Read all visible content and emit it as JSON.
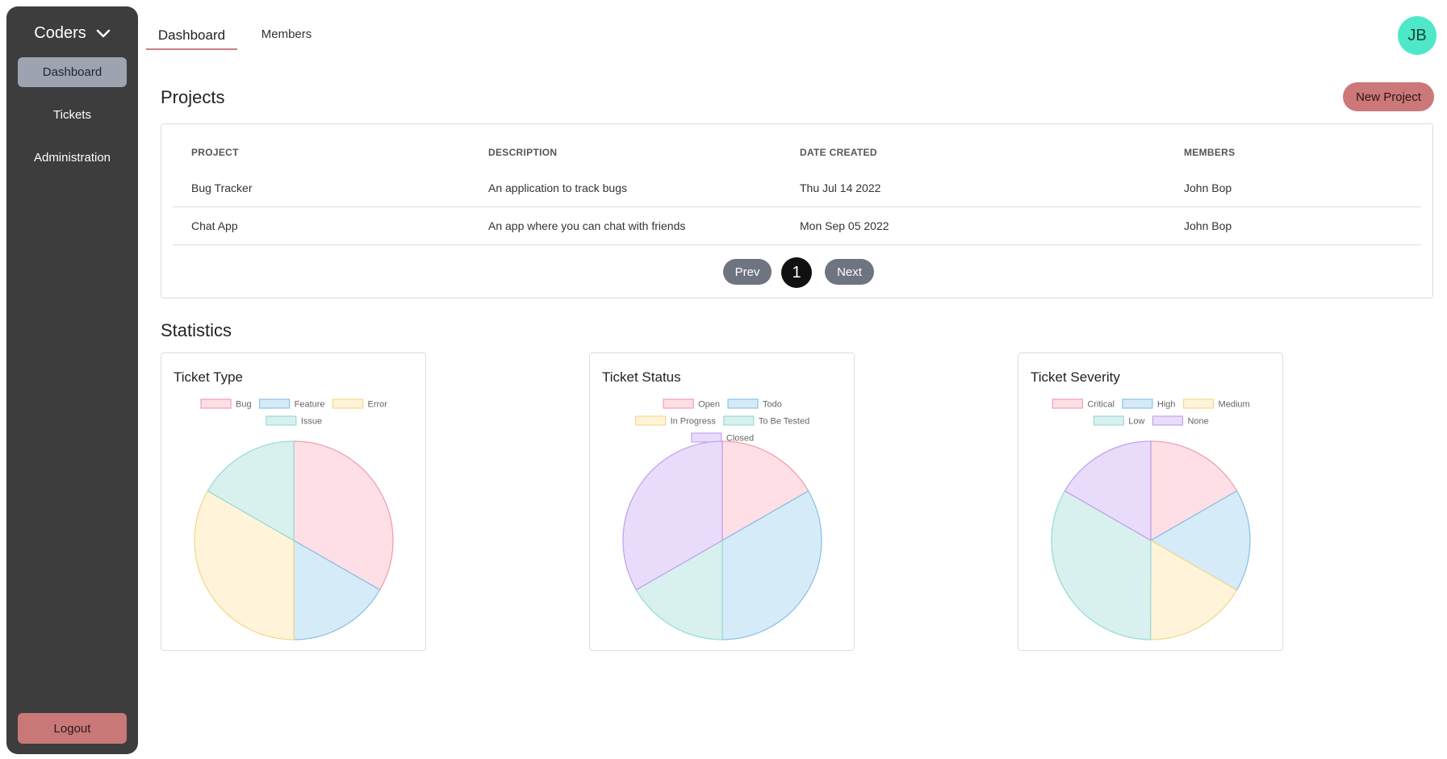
{
  "sidebar": {
    "org_name": "Coders",
    "items": [
      {
        "label": "Dashboard",
        "active": true
      },
      {
        "label": "Tickets",
        "active": false
      },
      {
        "label": "Administration",
        "active": false
      }
    ],
    "logout_label": "Logout"
  },
  "header": {
    "tabs": [
      {
        "label": "Dashboard",
        "active": true
      },
      {
        "label": "Members",
        "active": false
      }
    ],
    "avatar_initials": "JB"
  },
  "projects": {
    "title": "Projects",
    "new_project_label": "New Project",
    "columns": [
      "PROJECT",
      "DESCRIPTION",
      "DATE CREATED",
      "MEMBERS"
    ],
    "rows": [
      {
        "project": "Bug Tracker",
        "description": "An application to track bugs",
        "date": "Thu Jul 14 2022",
        "members": "John Bop"
      },
      {
        "project": "Chat App",
        "description": "An app where you can chat with friends",
        "date": "Mon Sep 05 2022",
        "members": "John Bop"
      }
    ],
    "pagination": {
      "prev_label": "Prev",
      "current_page": "1",
      "next_label": "Next"
    }
  },
  "statistics": {
    "title": "Statistics"
  },
  "chart_data": [
    {
      "type": "pie",
      "title": "Ticket Type",
      "labels": [
        "Bug",
        "Feature",
        "Error",
        "Issue"
      ],
      "values": [
        33.3,
        16.7,
        33.3,
        16.7
      ],
      "colors": [
        "#ffdfe6",
        "#d6ebf8",
        "#fff4d9",
        "#d8f1ee"
      ],
      "borders": [
        "#ef9eb2",
        "#8ec2e6",
        "#f3d88e",
        "#9bdcd6"
      ],
      "legend": "top"
    },
    {
      "type": "pie",
      "title": "Ticket Status",
      "labels": [
        "Open",
        "Todo",
        "In Progress",
        "To Be Tested",
        "Closed"
      ],
      "values": [
        16.7,
        33.3,
        0,
        16.7,
        33.3
      ],
      "colors": [
        "#ffdfe6",
        "#d6ebf8",
        "#fff4d9",
        "#d8f1ee",
        "#e9dcfa"
      ],
      "borders": [
        "#ef9eb2",
        "#8ec2e6",
        "#f3d88e",
        "#9bdcd6",
        "#c3a3ee"
      ],
      "legend": "top"
    },
    {
      "type": "pie",
      "title": "Ticket Severity",
      "labels": [
        "Critical",
        "High",
        "Medium",
        "Low",
        "None"
      ],
      "values": [
        16.7,
        16.7,
        16.7,
        33.3,
        16.7
      ],
      "colors": [
        "#ffdfe6",
        "#d6ebf8",
        "#fff4d9",
        "#d8f1ee",
        "#e9dcfa"
      ],
      "borders": [
        "#ef9eb2",
        "#8ec2e6",
        "#f3d88e",
        "#9bdcd6",
        "#c3a3ee"
      ],
      "legend": "top"
    }
  ]
}
